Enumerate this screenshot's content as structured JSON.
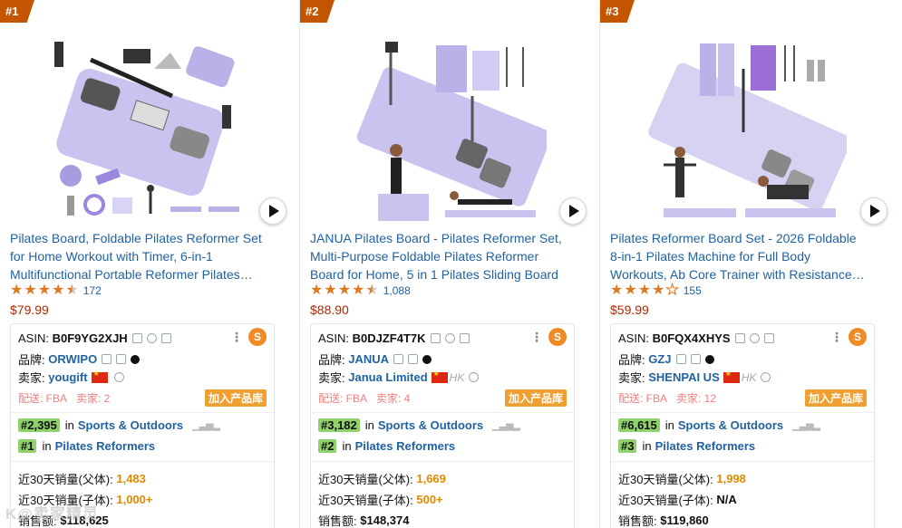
{
  "products": [
    {
      "rank": "#1",
      "title": "Pilates Board, Foldable Pilates Reformer Set for Home Workout with Timer, 6-in-1 Multifunctional Portable Reformer Pilates…",
      "stars": 4.5,
      "review_count": "172",
      "price": "$79.99",
      "asin_label": "ASIN:",
      "asin": "B0F9YG2XJH",
      "brand_label": "品牌:",
      "brand": "ORWIPO",
      "seller_label": "卖家:",
      "seller": "yougift",
      "seller_region": "",
      "fulfillment": "配送: FBA",
      "seller_count": "卖家: 2",
      "add_button": "加入产品库",
      "bsr_main": "#2,395",
      "bsr_main_in": "in",
      "bsr_main_cat": "Sports & Outdoors",
      "bsr_sub": "#1",
      "bsr_sub_in": "in",
      "bsr_sub_cat": "Pilates Reformers",
      "sales_parent_label": "近30天销量(父体):",
      "sales_parent": "1,483",
      "sales_child_label": "近30天销量(子体):",
      "sales_child": "1,000+",
      "revenue_label": "销售额:",
      "revenue": "$118,625"
    },
    {
      "rank": "#2",
      "title": "JANUA Pilates Board - Pilates Reformer Set, Multi-Purpose Foldable Pilates Reformer Board for Home, 5 in 1 Pilates Sliding Board",
      "stars": 4.5,
      "review_count": "1,088",
      "price": "$88.90",
      "asin_label": "ASIN:",
      "asin": "B0DJZF4T7K",
      "brand_label": "品牌:",
      "brand": "JANUA",
      "seller_label": "卖家:",
      "seller": "Janua Limited",
      "seller_region": "HK",
      "fulfillment": "配送: FBA",
      "seller_count": "卖家: 4",
      "add_button": "加入产品库",
      "bsr_main": "#3,182",
      "bsr_main_in": "in",
      "bsr_main_cat": "Sports & Outdoors",
      "bsr_sub": "#2",
      "bsr_sub_in": "in",
      "bsr_sub_cat": "Pilates Reformers",
      "sales_parent_label": "近30天销量(父体):",
      "sales_parent": "1,669",
      "sales_child_label": "近30天销量(子体):",
      "sales_child": "500+",
      "revenue_label": "销售额:",
      "revenue": "$148,374"
    },
    {
      "rank": "#3",
      "title": "Pilates Reformer Board Set - 2026 Foldable 8-in-1 Pilates Machine for Full Body Workouts, Ab Core Trainer with Resistance Bands,…",
      "stars": 4.0,
      "review_count": "155",
      "price": "$59.99",
      "asin_label": "ASIN:",
      "asin": "B0FQX4XHYS",
      "brand_label": "品牌:",
      "brand": "GZJ",
      "seller_label": "卖家:",
      "seller": "SHENPAI US",
      "seller_region": "HK",
      "fulfillment": "配送: FBA",
      "seller_count": "卖家: 12",
      "add_button": "加入产品库",
      "bsr_main": "#6,615",
      "bsr_main_in": "in",
      "bsr_main_cat": "Sports & Outdoors",
      "bsr_sub": "#3",
      "bsr_sub_in": "in",
      "bsr_sub_cat": "Pilates Reformers",
      "sales_parent_label": "近30天销量(父体):",
      "sales_parent": "1,998",
      "sales_child_label": "近30天销量(子体):",
      "sales_child": "N/A",
      "revenue_label": "销售额:",
      "revenue": "$119,860"
    }
  ],
  "icons": {
    "play": "play-icon",
    "copy": "copy-icon",
    "location": "location-pin-icon",
    "share": "share-icon",
    "tiktok": "tiktok-icon",
    "chart": "bar-chart-icon",
    "menu": "more-vertical-icon",
    "logo": "sellersprite-logo-icon"
  },
  "colors": {
    "rank_badge": "#c45500",
    "link": "#2162a1",
    "price": "#b12704",
    "star": "#de7921",
    "bsr_badge": "#8fd16a",
    "add_button": "#f0a030",
    "sales_value": "#e08a00"
  },
  "watermark": "K@卖家精灵"
}
